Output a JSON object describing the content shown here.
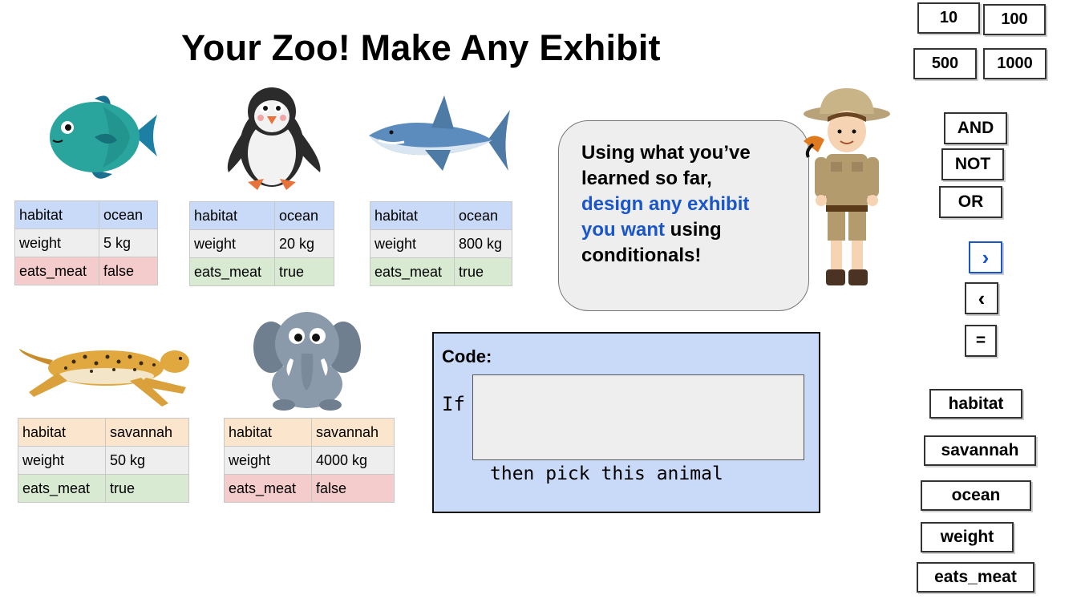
{
  "title": "Your Zoo! Make Any Exhibit",
  "animals": [
    {
      "name": "fish",
      "rows": [
        [
          "habitat",
          "ocean"
        ],
        [
          "weight",
          "5 kg"
        ],
        [
          "eats_meat",
          "false"
        ]
      ]
    },
    {
      "name": "penguin",
      "rows": [
        [
          "habitat",
          "ocean"
        ],
        [
          "weight",
          "20 kg"
        ],
        [
          "eats_meat",
          "true"
        ]
      ]
    },
    {
      "name": "shark",
      "rows": [
        [
          "habitat",
          "ocean"
        ],
        [
          "weight",
          "800 kg"
        ],
        [
          "eats_meat",
          "true"
        ]
      ]
    },
    {
      "name": "cheetah",
      "rows": [
        [
          "habitat",
          "savannah"
        ],
        [
          "weight",
          "50 kg"
        ],
        [
          "eats_meat",
          "true"
        ]
      ]
    },
    {
      "name": "elephant",
      "rows": [
        [
          "habitat",
          "savannah"
        ],
        [
          "weight",
          "4000 kg"
        ],
        [
          "eats_meat",
          "false"
        ]
      ]
    }
  ],
  "bubble": {
    "line1": "Using what you’ve",
    "line2": "learned so far,",
    "line3_blue": "design any exhibit",
    "line4_blue": "you want",
    "line4_rest": " using",
    "line5": "conditionals!"
  },
  "code": {
    "label": "Code:",
    "if_text": "If",
    "then_text": "then pick this animal",
    "input_value": ""
  },
  "tiles": {
    "num_10": "10",
    "num_100": "100",
    "num_500": "500",
    "num_1000": "1000",
    "and": "AND",
    "not": "NOT",
    "or": "OR",
    "gt": "›",
    "lt": "‹",
    "eq": "=",
    "habitat": "habitat",
    "savannah": "savannah",
    "ocean": "ocean",
    "weight": "weight",
    "eats_meat": "eats_meat"
  },
  "colors": {
    "ocean_cell": "#c9daf8",
    "savannah_cell": "#fce5cd",
    "weight_cell": "#eeeeee",
    "true_cell": "#d9ead3",
    "false_cell": "#f4cccc",
    "code_box": "#c9daf8",
    "blue_text": "#1a56c7",
    "gt_tile_border": "#1a56c7"
  }
}
